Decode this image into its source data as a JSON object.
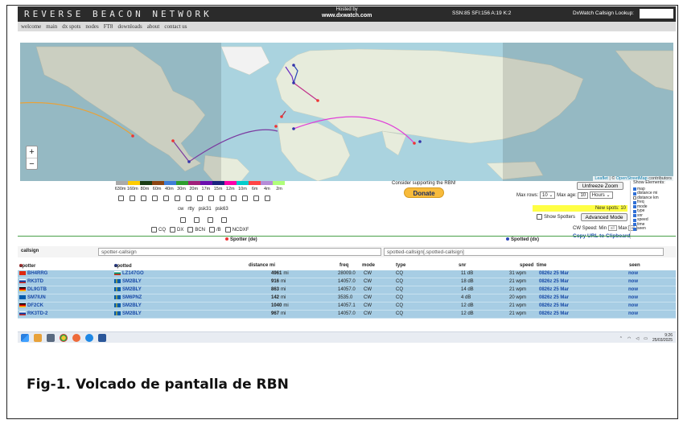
{
  "header": {
    "logo": "REVERSE BEACON NETWORK",
    "hosted_line1": "Hosted by",
    "hosted_line2": "www.dxwatch.com",
    "solar": "SSN:85 SFI:156 A:19 K:2",
    "lookup_label": "DxWatch Callsign Lookup:"
  },
  "nav": [
    "welcome",
    "main",
    "dx spots",
    "nodes",
    "FT8",
    "downloads",
    "about",
    "contact us"
  ],
  "map": {
    "zoom_in": "+",
    "zoom_out": "−",
    "attribution_leaflet": "Leaflet",
    "attribution_sep": " | © ",
    "attribution_osm": "OpenStreetMap",
    "attribution_tail": " contributors"
  },
  "bands": {
    "labels": [
      "630m",
      "160m",
      "80m",
      "60m",
      "40m",
      "30m",
      "20m",
      "17m",
      "15m",
      "12m",
      "10m",
      "6m",
      "4m",
      "2m"
    ],
    "colors": [
      "#aaaaaa",
      "#ffcc00",
      "#1a3d14",
      "#8b4513",
      "#3e7dd8",
      "#2e9e2e",
      "#a0207a",
      "#6a0dad",
      "#1a237e",
      "#ff00aa",
      "#00cccc",
      "#ff4444",
      "#b58cd8",
      "#b0ff7a"
    ]
  },
  "modes": [
    "cw",
    "rtty",
    "psk31",
    "psk63"
  ],
  "flags": [
    "CQ",
    "DX",
    "BCN",
    "/B",
    "NCDXF"
  ],
  "support": {
    "text": "Consider supporting the RBN!",
    "donate": "Donate"
  },
  "options": {
    "max_rows_label": "Max rows:",
    "max_rows_value": "10",
    "max_age_label": "Max age:",
    "max_age_value": "10",
    "max_age_unit": "Hours",
    "unfreeze": "Unfreeze Zoom",
    "new_spots": "New spots: 10",
    "show_spotters": "Show Spotters",
    "advanced_mode": "Advanced Mode",
    "cw_speed_label": "CW Speed:",
    "min_label": "Min",
    "min_value": "all",
    "max_label": "Max",
    "max_value": "all",
    "copy_url": "Copy URL to Clipboard"
  },
  "show_elements": {
    "title": "Show Elements:",
    "items": [
      {
        "label": "map",
        "on": true
      },
      {
        "label": "distance mi",
        "on": true
      },
      {
        "label": "distance km",
        "on": false
      },
      {
        "label": "freq",
        "on": true
      },
      {
        "label": "mode",
        "on": true
      },
      {
        "label": "type",
        "on": true
      },
      {
        "label": "snr",
        "on": true
      },
      {
        "label": "speed",
        "on": true
      },
      {
        "label": "time",
        "on": true
      },
      {
        "label": "seen",
        "on": true
      }
    ]
  },
  "filters": {
    "spotter_head": "Spotter (de)",
    "spotted_head": "Spotted (dx)",
    "row_label": "callsign",
    "spotter_placeholder": "spotter-callsign",
    "spotted_placeholder": "spotted-callsign[,spotted-callsign]"
  },
  "table": {
    "headers": {
      "spotter": "spotter",
      "spotted": "spotted",
      "distance": "distance mi",
      "freq": "freq",
      "mode": "mode",
      "type": "type",
      "snr": "snr",
      "speed": "speed",
      "time": "time",
      "seen": "seen"
    },
    "rows": [
      {
        "spotter": "BH4RRG",
        "spotted": "LZ147GO",
        "distance": "4961",
        "unit": "mi",
        "freq": "28009.0",
        "mode": "CW",
        "type": "CQ",
        "snr": "11 dB",
        "speed": "31 wpm",
        "time": "0826z 25 Mar",
        "seen": "now"
      },
      {
        "spotter": "RK3TD",
        "spotted": "SM2BLY",
        "distance": "916",
        "unit": "mi",
        "freq": "14057.0",
        "mode": "CW",
        "type": "CQ",
        "snr": "18 dB",
        "speed": "21 wpm",
        "time": "0826z 25 Mar",
        "seen": "now"
      },
      {
        "spotter": "DL9GTB",
        "spotted": "SM2BLY",
        "distance": "863",
        "unit": "mi",
        "freq": "14057.0",
        "mode": "CW",
        "type": "CQ",
        "snr": "14 dB",
        "speed": "21 wpm",
        "time": "0826z 25 Mar",
        "seen": "now"
      },
      {
        "spotter": "SM7IUN",
        "spotted": "SM6PNZ",
        "distance": "142",
        "unit": "mi",
        "freq": "3535.0",
        "mode": "CW",
        "type": "CQ",
        "snr": "4 dB",
        "speed": "20 wpm",
        "time": "0826z 25 Mar",
        "seen": "now"
      },
      {
        "spotter": "DF2CK",
        "spotted": "SM2BLY",
        "distance": "1040",
        "unit": "mi",
        "freq": "14057.1",
        "mode": "CW",
        "type": "CQ",
        "snr": "12 dB",
        "speed": "21 wpm",
        "time": "0826z 25 Mar",
        "seen": "now"
      },
      {
        "spotter": "RK3TD-2",
        "spotted": "SM2BLY",
        "distance": "967",
        "unit": "mi",
        "freq": "14057.0",
        "mode": "CW",
        "type": "CQ",
        "snr": "12 dB",
        "speed": "21 wpm",
        "time": "0826z 25 Mar",
        "seen": "now"
      }
    ]
  },
  "taskbar": {
    "time": "9:26",
    "date": "25/03/2025"
  },
  "caption": "Fig-1. Volcado de pantalla de RBN"
}
